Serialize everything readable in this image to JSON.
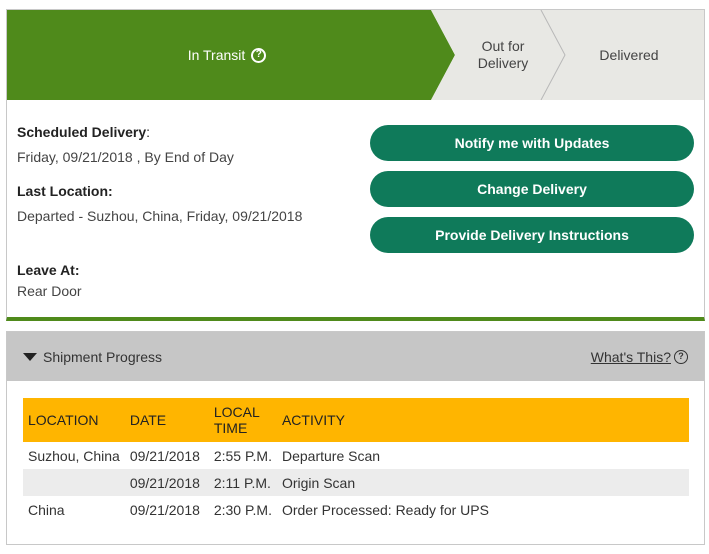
{
  "tracker": {
    "steps": [
      {
        "label": "In Transit",
        "active": true
      },
      {
        "label": "Out for Delivery",
        "line1": "Out for",
        "line2": "Delivery",
        "active": false
      },
      {
        "label": "Delivered",
        "active": false
      }
    ],
    "help_glyph": "?"
  },
  "details": {
    "scheduled_label": "Scheduled Delivery",
    "scheduled_colon": ":",
    "scheduled_value": "Friday, 09/21/2018 , By End of Day",
    "last_location_label": "Last Location:",
    "last_location_value": "Departed - Suzhou, China, Friday, 09/21/2018",
    "leave_at_label": "Leave At:",
    "leave_at_value": "Rear Door"
  },
  "actions": {
    "notify": "Notify me with Updates",
    "change": "Change Delivery",
    "instructions": "Provide Delivery Instructions"
  },
  "progress": {
    "title": "Shipment Progress",
    "whats_this": "What's This?",
    "help_glyph": "?",
    "columns": {
      "location": "LOCATION",
      "date": "DATE",
      "local_time_1": "LOCAL",
      "local_time_2": "TIME",
      "activity": "ACTIVITY"
    },
    "rows": [
      {
        "location": "Suzhou,  China",
        "date": "09/21/2018",
        "time": "2:55 P.M.",
        "activity": "Departure Scan"
      },
      {
        "location": "",
        "date": "09/21/2018",
        "time": "2:11 P.M.",
        "activity": "Origin Scan"
      },
      {
        "location": "China",
        "date": "09/21/2018",
        "time": "2:30 P.M.",
        "activity": "Order Processed: Ready for UPS"
      }
    ]
  },
  "colors": {
    "active_step": "#4f8a1b",
    "inactive_step": "#e8e8e4",
    "button": "#0f7a5a",
    "table_header": "#ffb500",
    "section_header": "#c6c6c6"
  },
  "icons": [
    "help-circle-icon",
    "caret-down-icon"
  ]
}
